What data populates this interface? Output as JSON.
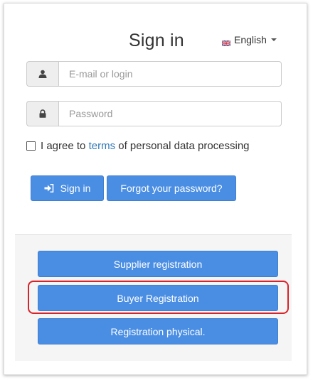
{
  "login": {
    "title": "Sign in",
    "language": {
      "selected": "English",
      "flag_icon": "uk-flag-icon"
    },
    "email": {
      "placeholder": "E-mail or login",
      "value": "",
      "icon": "user-icon"
    },
    "password": {
      "placeholder": "Password",
      "value": "",
      "icon": "lock-icon"
    },
    "agree": {
      "checked": false,
      "prefix": "I agree to",
      "link": "terms",
      "suffix": "of personal data processing"
    },
    "signin_label": "Sign in",
    "signin_icon": "sign-in-icon",
    "forgot_label": "Forgot your password?"
  },
  "registration": {
    "supplier_label": "Supplier registration",
    "buyer_label": "Buyer Registration",
    "physical_label": "Registration physical."
  },
  "colors": {
    "primary_button": "#4a8ee4",
    "link": "#337ab7",
    "highlight": "#d9222a",
    "panel_bg": "#f5f5f5"
  }
}
